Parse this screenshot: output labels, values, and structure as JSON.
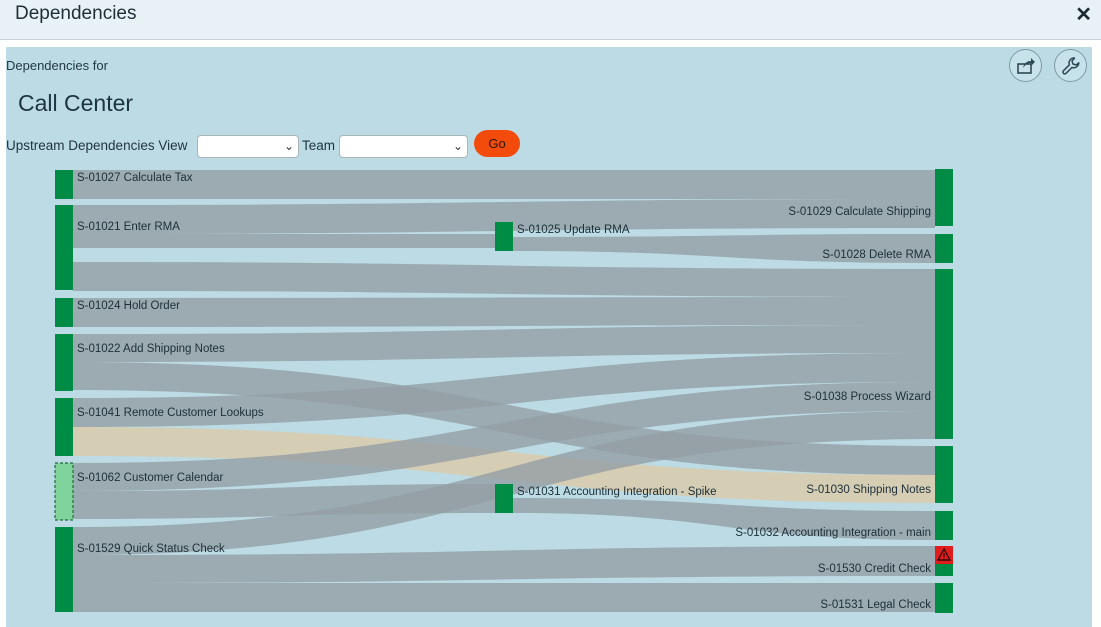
{
  "window": {
    "title": "Dependencies"
  },
  "panel": {
    "heading": "Dependencies for",
    "team": "Call Center"
  },
  "controls": {
    "view_label": "Upstream Dependencies View",
    "view_value": "",
    "team_label": "Team",
    "team_value": "",
    "go_label": "Go"
  },
  "icons": {
    "export": "share-export-icon",
    "settings": "wrench-icon",
    "close": "close-icon",
    "warning": "warning-icon"
  },
  "colors": {
    "node": "#008c45",
    "node_light": "#7fd39b",
    "link": "#949ea4",
    "link_highlight": "#d7cdb1",
    "warning": "#e01c1c",
    "go": "#f34b0c"
  },
  "chart_data": {
    "type": "sankey",
    "nodes": [
      {
        "id": "S-01027",
        "label": "S-01027 Calculate Tax",
        "column": 0
      },
      {
        "id": "S-01021",
        "label": "S-01021 Enter RMA",
        "column": 0
      },
      {
        "id": "S-01024",
        "label": "S-01024 Hold Order",
        "column": 0
      },
      {
        "id": "S-01022",
        "label": "S-01022 Add Shipping Notes",
        "column": 0
      },
      {
        "id": "S-01041",
        "label": "S-01041 Remote Customer Lookups",
        "column": 0
      },
      {
        "id": "S-01062",
        "label": "S-01062 Customer Calendar",
        "column": 0,
        "style": "dashed"
      },
      {
        "id": "S-01529",
        "label": "S-01529 Quick Status Check",
        "column": 0
      },
      {
        "id": "S-01025",
        "label": "S-01025 Update RMA",
        "column": 1
      },
      {
        "id": "S-01031",
        "label": "S-01031 Accounting Integration - Spike",
        "column": 1
      },
      {
        "id": "S-01029",
        "label": "S-01029 Calculate Shipping",
        "column": 2
      },
      {
        "id": "S-01028",
        "label": "S-01028 Delete RMA",
        "column": 2
      },
      {
        "id": "S-01038",
        "label": "S-01038 Process Wizard",
        "column": 2
      },
      {
        "id": "S-01030",
        "label": "S-01030 Shipping Notes",
        "column": 2
      },
      {
        "id": "S-01032",
        "label": "S-01032 Accounting Integration - main",
        "column": 2
      },
      {
        "id": "S-01530",
        "label": "S-01530 Credit Check",
        "column": 2,
        "warning": true
      },
      {
        "id": "S-01531",
        "label": "S-01531 Legal Check",
        "column": 2
      }
    ],
    "links": [
      {
        "source": "S-01027",
        "target": "S-01029",
        "value": 1
      },
      {
        "source": "S-01021",
        "target": "S-01029",
        "value": 1
      },
      {
        "source": "S-01021",
        "target": "S-01025",
        "value": 1
      },
      {
        "source": "S-01025",
        "target": "S-01028",
        "value": 1
      },
      {
        "source": "S-01021",
        "target": "S-01038",
        "value": 1
      },
      {
        "source": "S-01024",
        "target": "S-01038",
        "value": 1
      },
      {
        "source": "S-01022",
        "target": "S-01038",
        "value": 1
      },
      {
        "source": "S-01022",
        "target": "S-01030",
        "value": 1
      },
      {
        "source": "S-01041",
        "target": "S-01038",
        "value": 1
      },
      {
        "source": "S-01041",
        "target": "S-01030",
        "value": 1,
        "highlight": true
      },
      {
        "source": "S-01062",
        "target": "S-01038",
        "value": 1
      },
      {
        "source": "S-01062",
        "target": "S-01031",
        "value": 1
      },
      {
        "source": "S-01031",
        "target": "S-01032",
        "value": 1
      },
      {
        "source": "S-01529",
        "target": "S-01038",
        "value": 1
      },
      {
        "source": "S-01529",
        "target": "S-01530",
        "value": 1
      },
      {
        "source": "S-01529",
        "target": "S-01531",
        "value": 1
      }
    ]
  }
}
